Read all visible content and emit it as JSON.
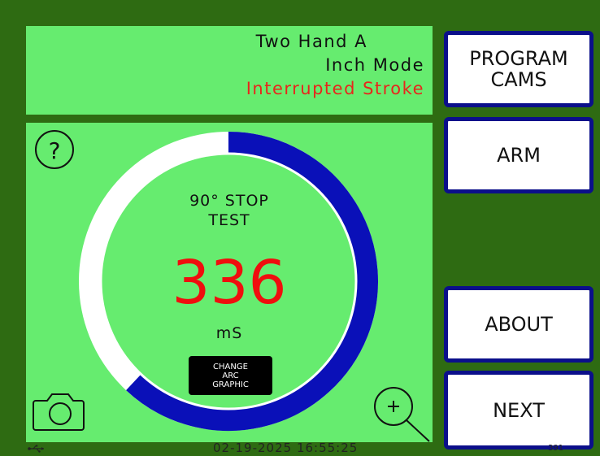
{
  "status": {
    "line1": "Two Hand A",
    "line2": "Inch Mode",
    "line3": "Interrupted Stroke",
    "line3_color": "#e8261c"
  },
  "buttons": {
    "program_cams": "PROGRAM\nCAMS",
    "arm": "ARM",
    "about": "ABOUT",
    "next": "NEXT"
  },
  "gauge": {
    "title": "90° STOP\nTEST",
    "value": "336",
    "unit": "mS",
    "arc_fill_fraction": 0.62,
    "arc_color": "#0a10b8",
    "track_color": "#ffffff",
    "change_arc_label": "CHANGE\nARC\nGRAPHIC",
    "icons": {
      "help": "question-circle-icon",
      "camera": "camera-icon",
      "zoom": "zoom-in-icon"
    }
  },
  "footer": {
    "datetime": "02-19-2025 16:55:25",
    "build": "391",
    "usb": "usb-icon"
  }
}
